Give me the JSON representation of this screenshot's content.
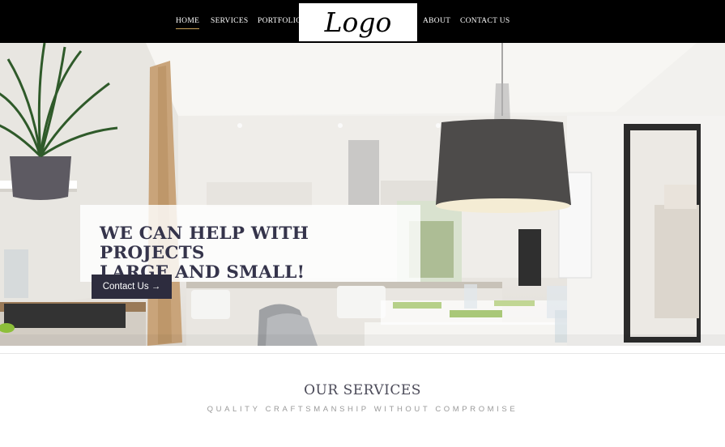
{
  "nav": {
    "items": [
      {
        "label": "HOME",
        "active": true
      },
      {
        "label": "SERVICES",
        "active": false
      },
      {
        "label": "PORTFOLIO",
        "active": false
      },
      {
        "label": "ABOUT",
        "active": false
      },
      {
        "label": "CONTACT US",
        "active": false
      }
    ],
    "logo": "Logo"
  },
  "hero": {
    "title_line1": "WE CAN HELP WITH PROJECTS",
    "title_line2": "LARGE AND SMALL!",
    "cta_label": "Contact Us →"
  },
  "services": {
    "title": "OUR SERVICES",
    "subtitle": "QUALITY CRAFTSMANSHIP WITHOUT COMPROMISE"
  },
  "colors": {
    "nav_bg": "#000000",
    "active_underline": "#c9a35b",
    "hero_title": "#35344b",
    "cta_bg": "#2d2c3e"
  }
}
